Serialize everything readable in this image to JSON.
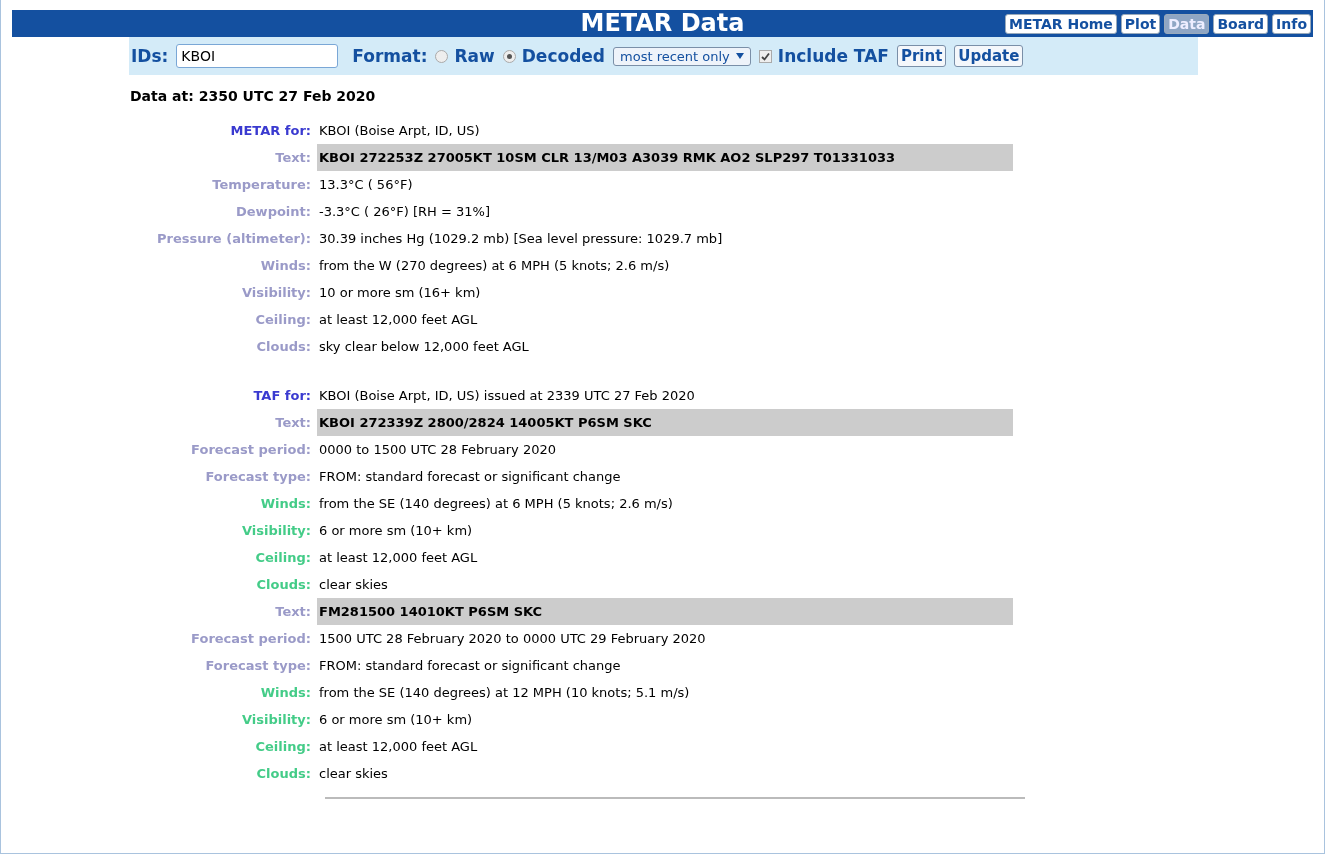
{
  "header": {
    "title": "METAR Data",
    "nav": [
      {
        "label": "METAR Home",
        "selected": false
      },
      {
        "label": "Plot",
        "selected": false
      },
      {
        "label": "Data",
        "selected": true
      },
      {
        "label": "Board",
        "selected": false
      },
      {
        "label": "Info",
        "selected": false
      }
    ]
  },
  "form": {
    "ids_label": "IDs:",
    "ids_value": "KBOI",
    "format_label": "Format:",
    "formats": [
      {
        "label": "Raw",
        "selected": false
      },
      {
        "label": "Decoded",
        "selected": true
      }
    ],
    "dropdown": "most recent only",
    "taf": {
      "label": "Include TAF",
      "checked": true
    },
    "buttons": [
      "Print",
      "Update"
    ]
  },
  "data_at": "Data at: 2350 UTC 27 Feb 2020",
  "sections": [
    {
      "rows": [
        {
          "kind": "for",
          "label": "METAR for:",
          "value": "KBOI (Boise Arpt, ID, US)"
        },
        {
          "kind": "text",
          "label": "Text:",
          "value": "KBOI 272253Z 27005KT 10SM CLR 13/M03 A3039 RMK AO2 SLP297 T01331033"
        },
        {
          "kind": "field",
          "label": "Temperature:",
          "value": "13.3°C ( 56°F)"
        },
        {
          "kind": "field",
          "label": "Dewpoint:",
          "value": "-3.3°C ( 26°F) [RH = 31%]"
        },
        {
          "kind": "field",
          "label": "Pressure (altimeter):",
          "value": "30.39 inches Hg (1029.2 mb) [Sea level pressure: 1029.7 mb]"
        },
        {
          "kind": "field",
          "label": "Winds:",
          "value": "from the W (270 degrees) at 6 MPH (5 knots; 2.6 m/s)"
        },
        {
          "kind": "field",
          "label": "Visibility:",
          "value": "10 or more sm (16+ km)"
        },
        {
          "kind": "field",
          "label": "Ceiling:",
          "value": "at least 12,000 feet AGL"
        },
        {
          "kind": "field",
          "label": "Clouds:",
          "value": "sky clear below 12,000 feet AGL"
        }
      ]
    },
    {
      "rows": [
        {
          "kind": "for",
          "label": "TAF for:",
          "value": "KBOI (Boise Arpt, ID, US) issued at 2339 UTC 27 Feb 2020"
        },
        {
          "kind": "text",
          "label": "Text:",
          "value": "KBOI 272339Z 2800/2824 14005KT P6SM SKC"
        },
        {
          "kind": "field",
          "label": "Forecast period:",
          "value": "0000 to 1500 UTC 28 February 2020"
        },
        {
          "kind": "field",
          "label": "Forecast type:",
          "value": "FROM: standard forecast or significant change"
        },
        {
          "kind": "group",
          "label": "Winds:",
          "value": "from the SE (140 degrees) at 6 MPH (5 knots; 2.6 m/s)"
        },
        {
          "kind": "group",
          "label": "Visibility:",
          "value": "6 or more sm (10+ km)"
        },
        {
          "kind": "group",
          "label": "Ceiling:",
          "value": "at least 12,000 feet AGL"
        },
        {
          "kind": "group",
          "label": "Clouds:",
          "value": "clear skies"
        },
        {
          "kind": "text",
          "label": "Text:",
          "value": "FM281500 14010KT P6SM SKC"
        },
        {
          "kind": "field",
          "label": "Forecast period:",
          "value": "1500 UTC 28 February 2020 to 0000 UTC 29 February 2020"
        },
        {
          "kind": "field",
          "label": "Forecast type:",
          "value": "FROM: standard forecast or significant change"
        },
        {
          "kind": "group",
          "label": "Winds:",
          "value": "from the SE (140 degrees) at 12 MPH (10 knots; 5.1 m/s)"
        },
        {
          "kind": "group",
          "label": "Visibility:",
          "value": "6 or more sm (10+ km)"
        },
        {
          "kind": "group",
          "label": "Ceiling:",
          "value": "at least 12,000 feet AGL"
        },
        {
          "kind": "group",
          "label": "Clouds:",
          "value": "clear skies"
        }
      ]
    }
  ]
}
